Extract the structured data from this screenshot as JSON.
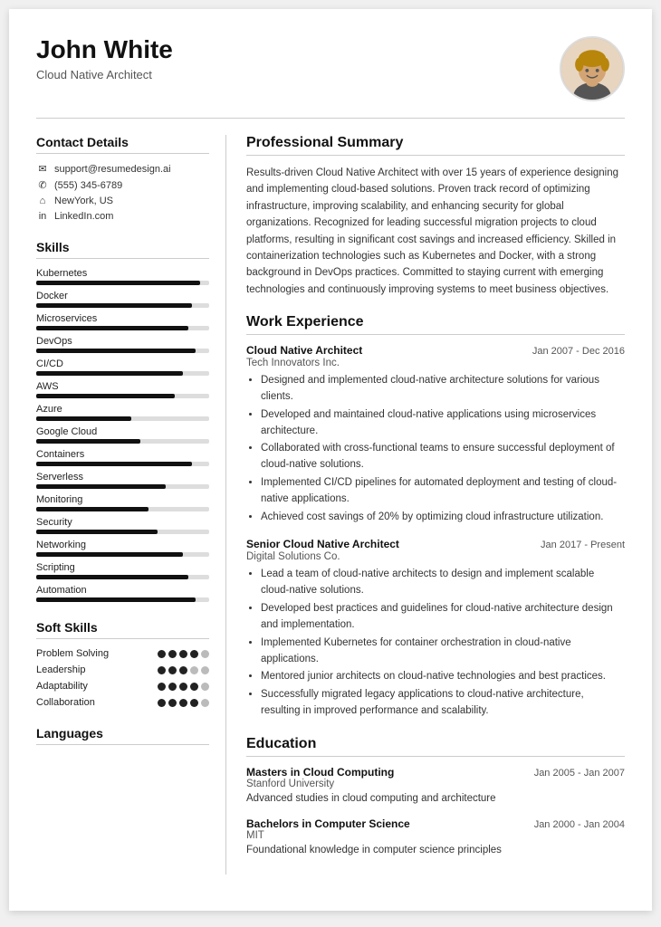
{
  "header": {
    "name": "John White",
    "title": "Cloud Native Architect",
    "avatar_alt": "Profile photo"
  },
  "sidebar": {
    "contact_section_title": "Contact Details",
    "contact_items": [
      {
        "icon": "✉",
        "text": "support@resumedesign.ai",
        "type": "email"
      },
      {
        "icon": "✆",
        "text": "(555) 345-6789",
        "type": "phone"
      },
      {
        "icon": "⌂",
        "text": "NewYork, US",
        "type": "address"
      },
      {
        "icon": "in",
        "text": "LinkedIn.com",
        "type": "linkedin"
      }
    ],
    "skills_section_title": "Skills",
    "skills": [
      {
        "name": "Kubernetes",
        "level": 95
      },
      {
        "name": "Docker",
        "level": 90
      },
      {
        "name": "Microservices",
        "level": 88
      },
      {
        "name": "DevOps",
        "level": 92
      },
      {
        "name": "CI/CD",
        "level": 85
      },
      {
        "name": "AWS",
        "level": 80
      },
      {
        "name": "Azure",
        "level": 55
      },
      {
        "name": "Google Cloud",
        "level": 60
      },
      {
        "name": "Containers",
        "level": 90
      },
      {
        "name": "Serverless",
        "level": 75
      },
      {
        "name": "Monitoring",
        "level": 65
      },
      {
        "name": "Security",
        "level": 70
      },
      {
        "name": "Networking",
        "level": 85
      },
      {
        "name": "Scripting",
        "level": 88
      },
      {
        "name": "Automation",
        "level": 92
      }
    ],
    "soft_skills_section_title": "Soft Skills",
    "soft_skills": [
      {
        "name": "Problem Solving",
        "filled": 4,
        "total": 5
      },
      {
        "name": "Leadership",
        "filled": 3,
        "total": 5
      },
      {
        "name": "Adaptability",
        "filled": 4,
        "total": 5
      },
      {
        "name": "Collaboration",
        "filled": 4,
        "total": 5
      }
    ],
    "languages_section_title": "Languages"
  },
  "main": {
    "summary_section_title": "Professional Summary",
    "summary_text": "Results-driven Cloud Native Architect with over 15 years of experience designing and implementing cloud-based solutions. Proven track record of optimizing infrastructure, improving scalability, and enhancing security for global organizations. Recognized for leading successful migration projects to cloud platforms, resulting in significant cost savings and increased efficiency. Skilled in containerization technologies such as Kubernetes and Docker, with a strong background in DevOps practices. Committed to staying current with emerging technologies and continuously improving systems to meet business objectives.",
    "work_section_title": "Work Experience",
    "jobs": [
      {
        "title": "Cloud Native Architect",
        "company": "Tech Innovators Inc.",
        "dates": "Jan 2007 - Dec 2016",
        "bullets": [
          "Designed and implemented cloud-native architecture solutions for various clients.",
          "Developed and maintained cloud-native applications using microservices architecture.",
          "Collaborated with cross-functional teams to ensure successful deployment of cloud-native solutions.",
          "Implemented CI/CD pipelines for automated deployment and testing of cloud-native applications.",
          "Achieved cost savings of 20% by optimizing cloud infrastructure utilization."
        ]
      },
      {
        "title": "Senior Cloud Native Architect",
        "company": "Digital Solutions Co.",
        "dates": "Jan 2017 - Present",
        "bullets": [
          "Lead a team of cloud-native architects to design and implement scalable cloud-native solutions.",
          "Developed best practices and guidelines for cloud-native architecture design and implementation.",
          "Implemented Kubernetes for container orchestration in cloud-native applications.",
          "Mentored junior architects on cloud-native technologies and best practices.",
          "Successfully migrated legacy applications to cloud-native architecture, resulting in improved performance and scalability."
        ]
      }
    ],
    "education_section_title": "Education",
    "education": [
      {
        "degree": "Masters in Cloud Computing",
        "school": "Stanford University",
        "dates": "Jan 2005 - Jan 2007",
        "description": "Advanced studies in cloud computing and architecture"
      },
      {
        "degree": "Bachelors in Computer Science",
        "school": "MIT",
        "dates": "Jan 2000 - Jan 2004",
        "description": "Foundational knowledge in computer science principles"
      }
    ]
  }
}
